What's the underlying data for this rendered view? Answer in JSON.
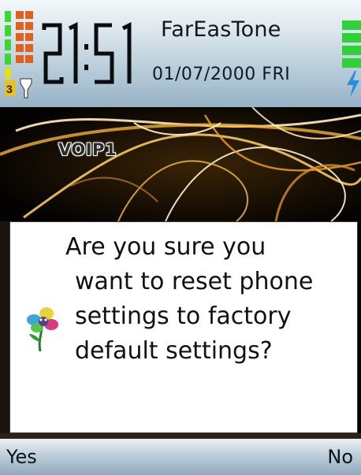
{
  "status": {
    "time": "21:51",
    "operator": "FarEasTone",
    "date": "01/07/2000 FRI",
    "signal_level": 5,
    "battery_level": 5
  },
  "wallpaper": {
    "label": "VOIP1"
  },
  "dialog": {
    "lines": [
      "Are you sure you",
      "want to reset phone",
      "settings to factory",
      "default settings?"
    ],
    "icon": "flower-question-icon"
  },
  "softkeys": {
    "left": "Yes",
    "right": "No"
  },
  "colors": {
    "status_top": "#f3f7f9",
    "status_bottom": "#97b3c6",
    "signal_green": "#3dd636",
    "battery_green": "#30d03a",
    "glow_gold": "#f2b233"
  }
}
